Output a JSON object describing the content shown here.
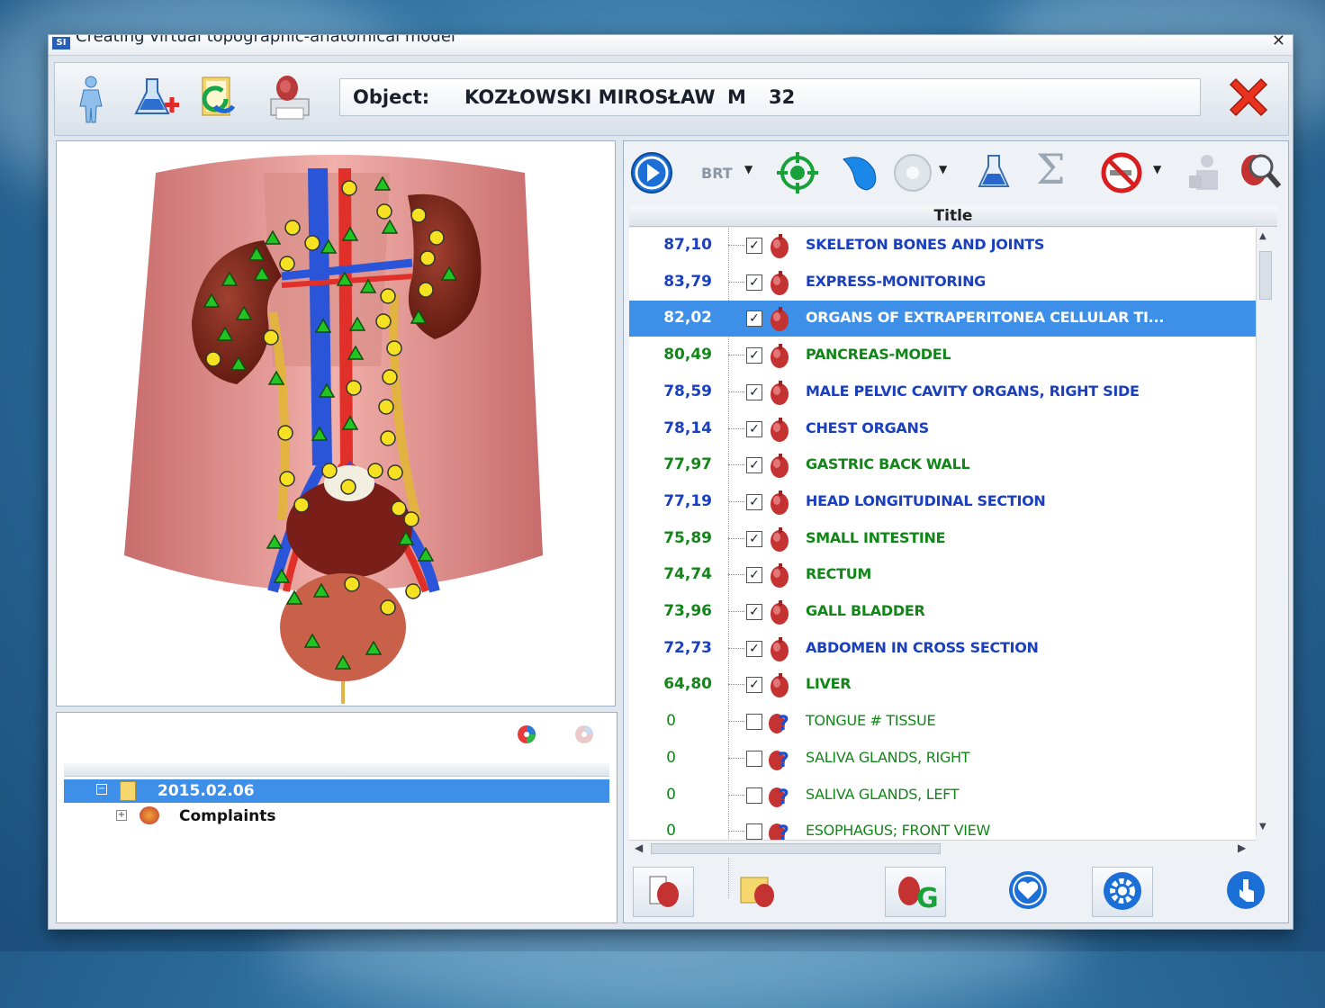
{
  "window": {
    "title": "Creating virtual topographic-anatomical model",
    "app_badge": "SI"
  },
  "toolbar": {
    "icons": [
      "human-body-icon",
      "flask-add-icon",
      "folder-refresh-icon",
      "organ-print-icon"
    ],
    "object_label": "Object:",
    "patient_name": "KOZŁOWSKI MIROSŁAW",
    "sex": "M",
    "age": "32",
    "close_icon": "red-x-icon"
  },
  "analysis_toolbar": {
    "brt_label": "BRT",
    "icons": [
      "play-icon",
      "brt-dropdown",
      "target-icon",
      "blue-shape-icon",
      "disc-dropdown-icon",
      "flask-icon",
      "sigma-icon",
      "no-smoking-icon",
      "person-bag-icon",
      "organ-search-icon"
    ]
  },
  "grid": {
    "header_title": "Title",
    "rows": [
      {
        "value": "87,10",
        "label": "SKELETON BONES AND JOINTS",
        "checked": true,
        "color": "#1a3fbf",
        "icon": "heart-organ-icon"
      },
      {
        "value": "83,79",
        "label": "EXPRESS-MONITORING",
        "checked": true,
        "color": "#1a3fbf",
        "icon": "heart-organ-icon"
      },
      {
        "value": "82,02",
        "label": "ORGANS OF EXTRAPERITONEA CELLULAR TI...",
        "checked": true,
        "color": "#1b9e1b",
        "icon": "heart-organ-icon",
        "selected": true
      },
      {
        "value": "80,49",
        "label": "PANCREAS-MODEL",
        "checked": true,
        "color": "#13861a",
        "icon": "heart-organ-icon"
      },
      {
        "value": "78,59",
        "label": "MALE PELVIC CAVITY ORGANS, RIGHT SIDE",
        "checked": true,
        "color": "#1a3fbf",
        "icon": "heart-organ-icon"
      },
      {
        "value": "78,14",
        "label": "CHEST ORGANS",
        "checked": true,
        "color": "#1a3fbf",
        "icon": "heart-organ-icon"
      },
      {
        "value": "77,97",
        "label": "GASTRIC BACK WALL",
        "checked": true,
        "color": "#13861a",
        "icon": "heart-organ-icon"
      },
      {
        "value": "77,19",
        "label": "HEAD LONGITUDINAL SECTION",
        "checked": true,
        "color": "#1a3fbf",
        "icon": "heart-organ-icon"
      },
      {
        "value": "75,89",
        "label": "SMALL INTESTINE",
        "checked": true,
        "color": "#13861a",
        "icon": "heart-organ-icon"
      },
      {
        "value": "74,74",
        "label": "RECTUM",
        "checked": true,
        "color": "#13861a",
        "icon": "heart-organ-icon"
      },
      {
        "value": "73,96",
        "label": "GALL BLADDER",
        "checked": true,
        "color": "#13861a",
        "icon": "heart-organ-icon"
      },
      {
        "value": "72,73",
        "label": "ABDOMEN IN CROSS SECTION",
        "checked": true,
        "color": "#1a3fbf",
        "icon": "heart-organ-icon"
      },
      {
        "value": "64,80",
        "label": "LIVER",
        "checked": true,
        "color": "#13861a",
        "icon": "heart-organ-icon"
      },
      {
        "value": "0",
        "label": "TONGUE # TISSUE",
        "checked": false,
        "color": "#13861a",
        "icon": "question-organ-icon"
      },
      {
        "value": "0",
        "label": "SALIVA GLANDS, RIGHT",
        "checked": false,
        "color": "#13861a",
        "icon": "question-organ-icon"
      },
      {
        "value": "0",
        "label": "SALIVA GLANDS, LEFT",
        "checked": false,
        "color": "#13861a",
        "icon": "question-organ-icon"
      },
      {
        "value": "0",
        "label": "ESOPHAGUS; FRONT VIEW",
        "checked": false,
        "color": "#13861a",
        "icon": "question-organ-icon"
      }
    ]
  },
  "history": {
    "date_node": "2015.02.06",
    "child_node": "Complaints"
  },
  "bottom_toolbar": {
    "icons": [
      "report-organ-icon",
      "folder-organ-icon",
      "organ-g-icon",
      "heart-button-icon",
      "settings-gear-icon",
      "hand-pointer-icon"
    ]
  },
  "colors": {
    "selection": "#3d8fe8",
    "value_blue": "#1a3fbf",
    "value_green": "#13861a"
  }
}
